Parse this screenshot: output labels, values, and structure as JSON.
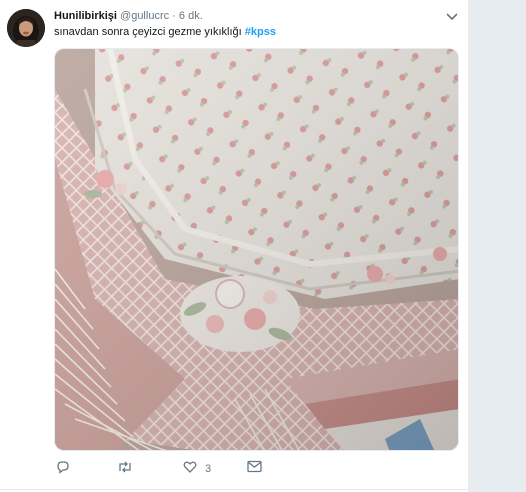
{
  "tweet": {
    "display_name": "Hunilibirkişi",
    "handle": "@gullucrc",
    "separator": "·",
    "time": "6 dk.",
    "text": "sınavdan sonra çeyizci gezme yıkıklığı",
    "hashtag": "#kpss",
    "media_description_icon": "photo-carpet",
    "actions": {
      "reply_count": "",
      "retweet_count": "",
      "like_count": "3",
      "dm_count": ""
    }
  },
  "colors": {
    "accent": "#1da1f2",
    "muted": "#657786",
    "gutter": "#e6ecf0"
  },
  "icons": {
    "caret": "chevron-down-icon",
    "reply": "reply-icon",
    "retweet": "retweet-icon",
    "like": "heart-icon",
    "dm": "envelope-icon"
  }
}
